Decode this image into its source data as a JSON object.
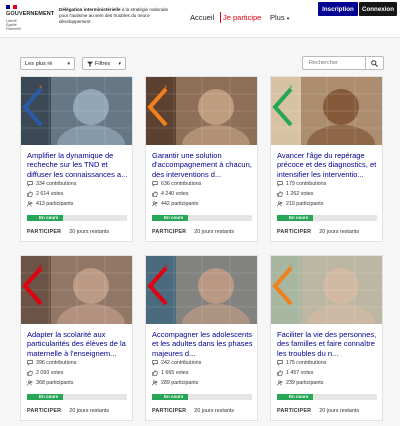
{
  "header": {
    "logo_line1": "RÉPUBLIQUE",
    "logo_line2": "FRANÇAISE",
    "logo_title": "GOUVERNEMENT",
    "logo_motto": "Liberté Égalité Fraternité",
    "delegation_bold": "Délégation interministérielle",
    "delegation_text": "à la stratégie nationale pour l'autisme au sein des troubles du neuro-développement",
    "nav": {
      "accueil": "Accueil",
      "participe": "Je participe",
      "plus": "Plus"
    },
    "inscription": "Inscription",
    "connexion": "Connexion"
  },
  "toolbar": {
    "sort_value": "Les plus ré",
    "filter_label": "Filtres",
    "search_placeholder": "Rechercher"
  },
  "colors": {
    "primary": "#000091",
    "accent": "#e1000f",
    "success": "#27a658"
  },
  "cards": [
    {
      "title": "Amplifier la dynamique de recheche sur les TND et diffuser les connaissances a...",
      "contributions": "334 contributions",
      "votes": "2 614 votes",
      "participants": "413 participants",
      "status": "En cours",
      "progress_pct": 36,
      "action": "PARTICIPER",
      "remaining": "20 jours restants"
    },
    {
      "title": "Garantir une solution d'accompagnement à chacun, des interventions d...",
      "contributions": "636 contributions",
      "votes": "4 240 votes",
      "participants": "442 participants",
      "status": "En cours",
      "progress_pct": 36,
      "action": "PARTICIPER",
      "remaining": "20 jours restants"
    },
    {
      "title": "Avancer l'âge du repérage précoce et des diagnostics, et intensifier les interventio...",
      "contributions": "179 contributions",
      "votes": "1 262 votes",
      "participants": "219 participants",
      "status": "En cours",
      "progress_pct": 36,
      "action": "PARTICIPER",
      "remaining": "20 jours restants"
    },
    {
      "title": "Adapter la scolarité aux particularités des élèves de la maternelle à l'enseignem...",
      "contributions": "396 contributions",
      "votes": "2 093 votes",
      "participants": "368 participants",
      "status": "En cours",
      "progress_pct": 36,
      "action": "PARTICIPER",
      "remaining": "20 jours restants"
    },
    {
      "title": "Accompagner les adolescents et les adultes dans les phases majeures d...",
      "contributions": "242 contributions",
      "votes": "1 665 votes",
      "participants": "289 participants",
      "status": "En cours",
      "progress_pct": 36,
      "action": "PARTICIPER",
      "remaining": "20 jours restants"
    },
    {
      "title": "Faciliter la vie des personnes, des familles et faire connaître les troubles du n...",
      "contributions": "175 contributions",
      "votes": "1 457 votes",
      "participants": "239 participants",
      "status": "En cours",
      "progress_pct": 36,
      "action": "PARTICIPER",
      "remaining": "20 jours restants"
    }
  ]
}
